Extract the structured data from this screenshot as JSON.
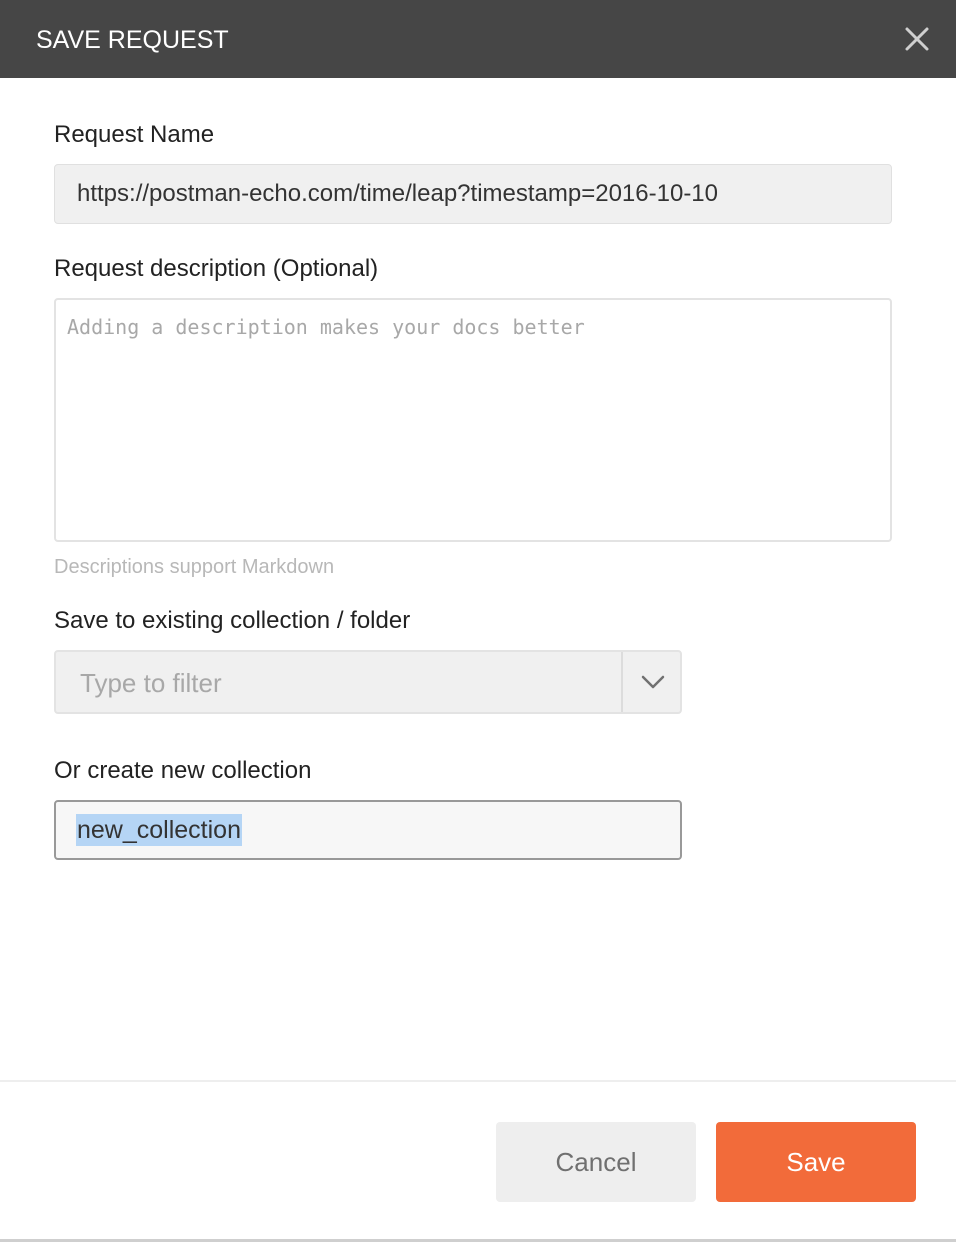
{
  "dialog": {
    "title": "SAVE REQUEST",
    "close_icon": "close-icon"
  },
  "request_name": {
    "label": "Request Name",
    "value": "https://postman-echo.com/time/leap?timestamp=2016-10-10"
  },
  "request_description": {
    "label": "Request description (Optional)",
    "placeholder": "Adding a description makes your docs better",
    "hint": "Descriptions support Markdown"
  },
  "existing_collection": {
    "label": "Save to existing collection / folder",
    "placeholder": "Type to filter",
    "dropdown_icon": "chevron-down-icon"
  },
  "new_collection": {
    "label": "Or create new collection",
    "value": "new_collection"
  },
  "footer": {
    "cancel_label": "Cancel",
    "save_label": "Save"
  },
  "colors": {
    "header_bg": "#464646",
    "save_button": "#f26b3a",
    "cancel_button": "#eeeeee",
    "selection_highlight": "#b5d5f5"
  }
}
